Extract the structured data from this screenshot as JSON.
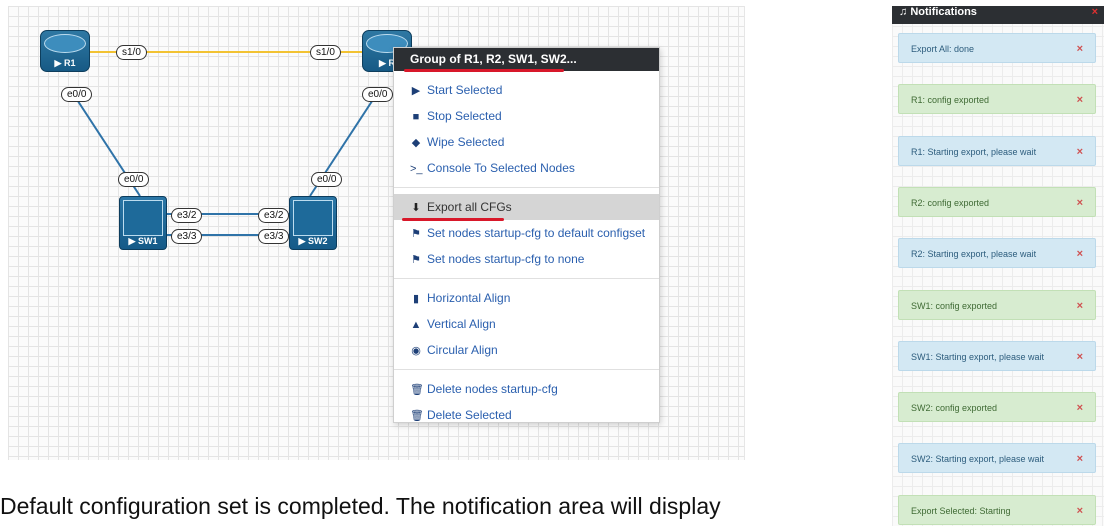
{
  "topology": {
    "nodes": {
      "r1": "R1",
      "r2": "R",
      "sw1": "SW1",
      "sw2": "SW2"
    },
    "ports": {
      "r1_s": "s1/0",
      "r2_s": "s1/0",
      "r1_e": "e0/0",
      "r2_e": "e0/0",
      "sw1_e": "e0/0",
      "sw2_e": "e0/0",
      "sw1_e32": "e3/2",
      "sw2_e32": "e3/2",
      "sw1_e33": "e3/3",
      "sw2_e33": "e3/3"
    },
    "colors": {
      "serial_link": "#f2c232",
      "eth_link": "#2f73a8"
    }
  },
  "context_menu": {
    "header": "Group of R1, R2, SW1, SW2...",
    "groups": [
      [
        {
          "icon": "play-icon",
          "glyph": "▶",
          "label": "Start Selected"
        },
        {
          "icon": "stop-icon",
          "glyph": "■",
          "label": "Stop Selected"
        },
        {
          "icon": "eraser-icon",
          "glyph": "◆",
          "label": "Wipe Selected"
        },
        {
          "icon": "terminal-icon",
          "glyph": ">_",
          "label": "Console To Selected Nodes"
        }
      ],
      [
        {
          "icon": "download-icon",
          "glyph": "⬇",
          "label": "Export all CFGs",
          "highlight": true
        },
        {
          "icon": "config-set-icon",
          "glyph": "⚑",
          "label": "Set nodes startup-cfg to default configset"
        },
        {
          "icon": "config-none-icon",
          "glyph": "⚑",
          "label": "Set nodes startup-cfg to none"
        }
      ],
      [
        {
          "icon": "horizontal-align-icon",
          "glyph": "▮",
          "label": "Horizontal Align"
        },
        {
          "icon": "vertical-align-icon",
          "glyph": "▲",
          "label": "Vertical Align"
        },
        {
          "icon": "circular-align-icon",
          "glyph": "◉",
          "label": "Circular Align"
        }
      ],
      [
        {
          "icon": "trash-icon",
          "glyph": "🗑",
          "label": "Delete nodes startup-cfg"
        },
        {
          "icon": "trash-icon",
          "glyph": "🗑",
          "label": "Delete Selected"
        }
      ]
    ]
  },
  "notifications": {
    "title": "Notifications",
    "bell_glyph": "♫",
    "close_glyph": "×",
    "items": [
      {
        "text": "Export All: done",
        "type": "info"
      },
      {
        "text": "R1: config exported",
        "type": "success"
      },
      {
        "text": "R1: Starting export, please wait",
        "type": "info"
      },
      {
        "text": "R2: config exported",
        "type": "success"
      },
      {
        "text": "R2: Starting export, please wait",
        "type": "info"
      },
      {
        "text": "SW1: config exported",
        "type": "success"
      },
      {
        "text": "SW1: Starting export, please wait",
        "type": "info"
      },
      {
        "text": "SW2: config exported",
        "type": "success"
      },
      {
        "text": "SW2: Starting export, please wait",
        "type": "info"
      },
      {
        "text": "Export Selected: Starting",
        "type": "success"
      }
    ]
  },
  "caption": "Default configuration set is completed. The notification area will display"
}
